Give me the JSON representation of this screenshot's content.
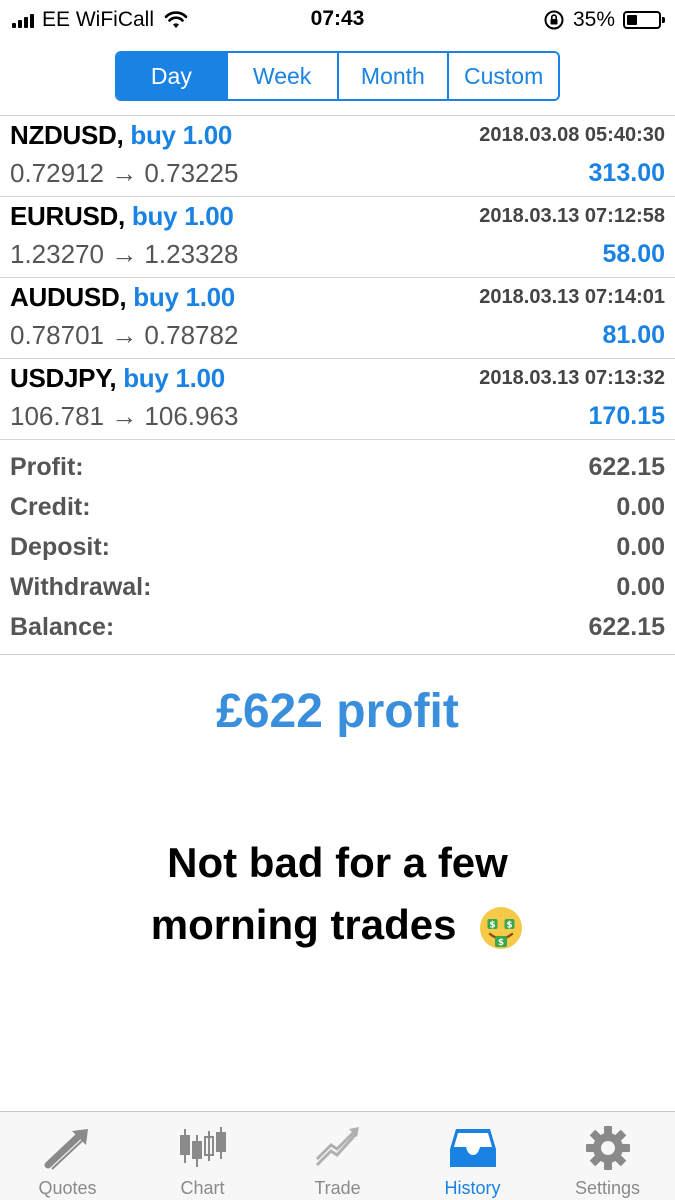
{
  "status_bar": {
    "carrier": "EE WiFiCall",
    "time": "07:43",
    "battery": "35%"
  },
  "segmented": [
    "Day",
    "Week",
    "Month",
    "Custom"
  ],
  "trades": [
    {
      "symbol": "NZDUSD,",
      "side": "buy 1.00",
      "time": "2018.03.08 05:40:30",
      "prices": "0.72912 → 0.73225",
      "profit": "313.00"
    },
    {
      "symbol": "EURUSD,",
      "side": "buy 1.00",
      "time": "2018.03.13 07:12:58",
      "prices": "1.23270 → 1.23328",
      "profit": "58.00"
    },
    {
      "symbol": "AUDUSD,",
      "side": "buy 1.00",
      "time": "2018.03.13 07:14:01",
      "prices": "0.78701 → 0.78782",
      "profit": "81.00"
    },
    {
      "symbol": "USDJPY,",
      "side": "buy 1.00",
      "time": "2018.03.13 07:13:32",
      "prices": "106.781 → 106.963",
      "profit": "170.15"
    }
  ],
  "summary": [
    {
      "label": "Profit:",
      "value": "622.15"
    },
    {
      "label": "Credit:",
      "value": "0.00"
    },
    {
      "label": "Deposit:",
      "value": "0.00"
    },
    {
      "label": "Withdrawal:",
      "value": "0.00"
    },
    {
      "label": "Balance:",
      "value": "622.15"
    }
  ],
  "caption": {
    "profit": "£622 profit",
    "line1": "Not bad for a few",
    "line2": "morning trades"
  },
  "tabs": [
    {
      "label": "Quotes",
      "icon": "quotes-arrow-icon"
    },
    {
      "label": "Chart",
      "icon": "candlestick-icon"
    },
    {
      "label": "Trade",
      "icon": "trade-trend-icon"
    },
    {
      "label": "History",
      "icon": "inbox-tray-icon"
    },
    {
      "label": "Settings",
      "icon": "gear-icon"
    }
  ],
  "colors": {
    "accent": "#1a82e2",
    "caption_blue": "#3a8fdc",
    "muted": "#555555",
    "tab_inactive": "#8a8a8a"
  }
}
